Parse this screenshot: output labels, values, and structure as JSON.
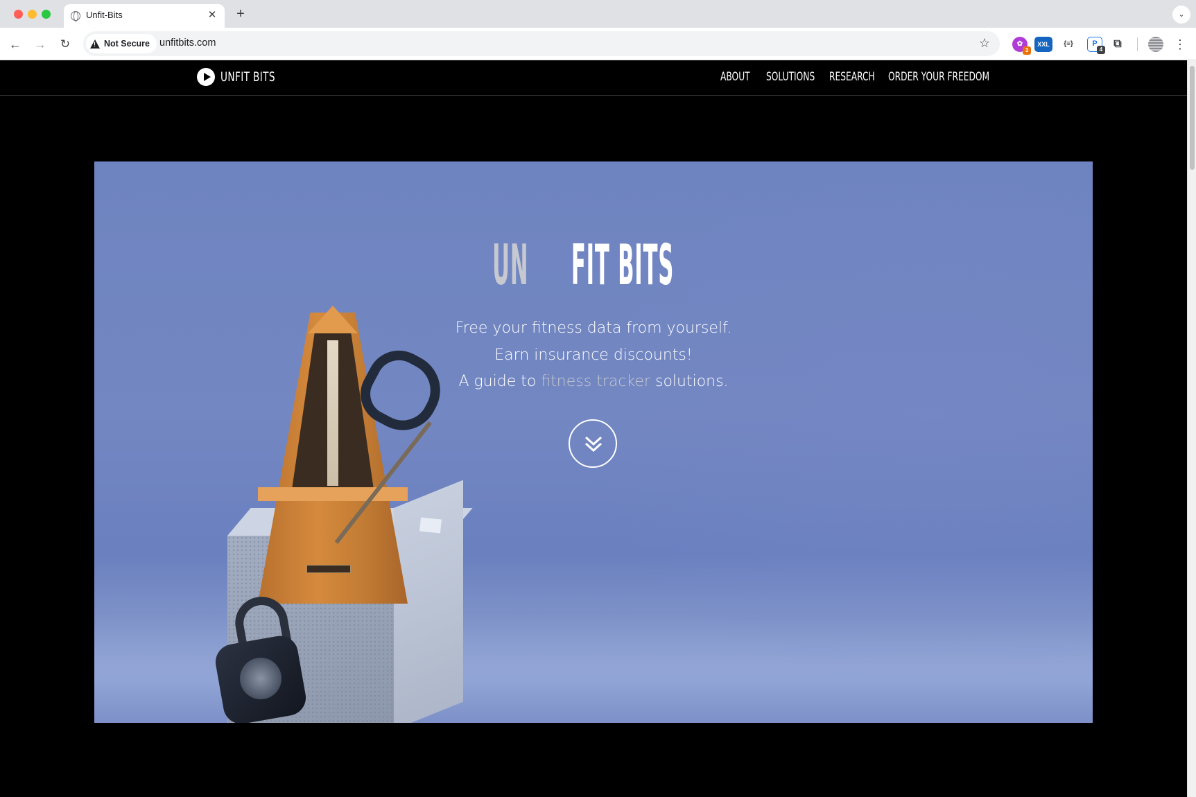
{
  "browser": {
    "tab_title": "Unfit-Bits",
    "tab_close": "✕",
    "new_tab": "+",
    "tab_menu": "⌄",
    "security_label": "Not Secure",
    "url": "unfitbits.com",
    "extensions": [
      {
        "name": "puzzle-extension",
        "badge": "3"
      },
      {
        "name": "xxl-extension",
        "label": "XXL"
      },
      {
        "name": "json-extension",
        "label": "{≡}"
      },
      {
        "name": "pass-extension",
        "label": "P",
        "badge": "4"
      }
    ]
  },
  "site": {
    "logo_text": "UNFIT BITS",
    "nav": [
      "ABOUT",
      "SOLUTIONS",
      "RESEARCH",
      "ORDER YOUR FREEDOM"
    ],
    "hero": {
      "title_un": "UN",
      "title_rest": "FIT BITS",
      "line1": "Free your fitness data from yourself.",
      "line2": "Earn insurance discounts!",
      "line3_prefix": "A guide to ",
      "line3_link": "fitness tracker",
      "line3_suffix": " solutions."
    }
  },
  "colors": {
    "hero_background": "#7387c2",
    "title_un": "#c6c9d0",
    "link": "#c7c9cf"
  }
}
